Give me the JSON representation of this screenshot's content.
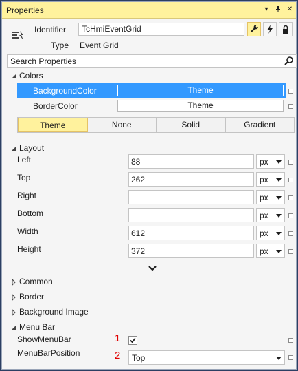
{
  "window": {
    "title": "Properties",
    "buttons": {
      "dropdown": "▾",
      "pin": "📌",
      "close": "✕"
    }
  },
  "header": {
    "identifier_label": "Identifier",
    "identifier_value": "TcHmiEventGrid",
    "type_label": "Type",
    "type_value": "Event Grid",
    "views": [
      "wrench-icon",
      "lightning-icon",
      "lock-icon"
    ]
  },
  "search": {
    "placeholder": "Search Properties"
  },
  "categories": {
    "colors": "Colors",
    "layout": "Layout",
    "common": "Common",
    "border": "Border",
    "background_image": "Background Image",
    "menu_bar": "Menu Bar"
  },
  "colors": {
    "rows": [
      {
        "name": "BackgroundColor",
        "value": "Theme"
      },
      {
        "name": "BorderColor",
        "value": "Theme"
      }
    ],
    "segments": [
      "Theme",
      "None",
      "Solid",
      "Gradient"
    ],
    "selected_segment": "Theme"
  },
  "layout": {
    "rows": [
      {
        "name": "Left",
        "value": "88",
        "unit": "px"
      },
      {
        "name": "Top",
        "value": "262",
        "unit": "px"
      },
      {
        "name": "Right",
        "value": "",
        "unit": "px"
      },
      {
        "name": "Bottom",
        "value": "",
        "unit": "px"
      },
      {
        "name": "Width",
        "value": "612",
        "unit": "px"
      },
      {
        "name": "Height",
        "value": "372",
        "unit": "px"
      }
    ]
  },
  "menu_bar": {
    "show_label": "ShowMenuBar",
    "show_checked": true,
    "position_label": "MenuBarPosition",
    "position_value": "Top",
    "marker_1": "1",
    "marker_2": "2"
  },
  "colors_palette": {
    "accent": "#fff29d",
    "selection": "#3399ff",
    "marker": "#e00000"
  }
}
